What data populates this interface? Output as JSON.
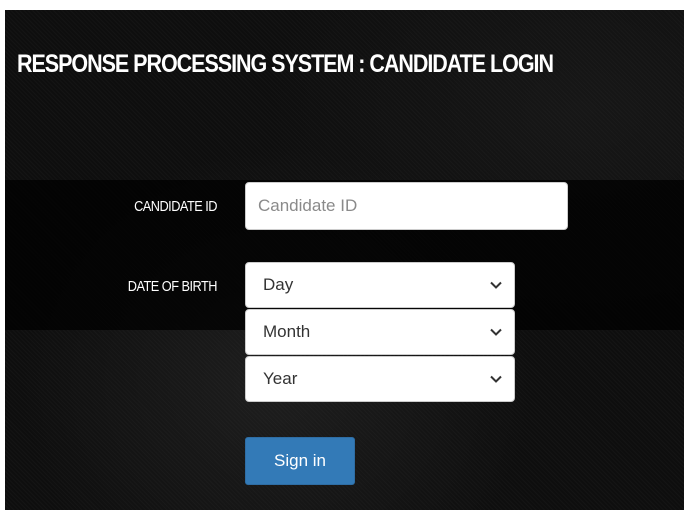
{
  "header": {
    "title": "RESPONSE PROCESSING SYSTEM : CANDIDATE LOGIN"
  },
  "form": {
    "candidate_id_label": "CANDIDATE ID",
    "candidate_id_value": "",
    "candidate_id_placeholder": "Candidate ID",
    "dob_label": "DATE OF BIRTH",
    "day_select": "Day",
    "month_select": "Month",
    "year_select": "Year",
    "submit_label": "Sign in"
  },
  "icons": {
    "dropdown": "chevron-down-icon"
  },
  "colors": {
    "background": "#0e0e0e",
    "button": "#337ab7",
    "text": "#ffffff"
  }
}
